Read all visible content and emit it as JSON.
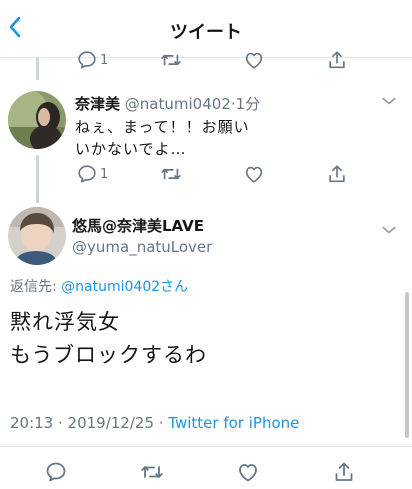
{
  "nav": {
    "title": "ツイート"
  },
  "previous_actions": {
    "reply_count": "1"
  },
  "reply_tweet": {
    "display_name": "奈津美",
    "handle": "@natumi0402",
    "separator": "·",
    "time": "1分",
    "text_line1": "ねぇ、まって！！お願い",
    "text_line2": "いかないでよ…",
    "reply_count": "1"
  },
  "main_tweet": {
    "display_name": "悠馬@奈津美LAVE",
    "handle": "@yuma_natuLover",
    "reply_prefix": "返信先: ",
    "reply_to": "@natumi0402さん",
    "text_line1": "黙れ浮気女",
    "text_line2": "もうブロックするわ",
    "timestamp": "20:13 · 2019/12/25 · ",
    "client": "Twitter for iPhone"
  },
  "colors": {
    "link": "#1b95e0",
    "secondary": "#657786",
    "divider": "#e1e8ed",
    "icon": "#657786"
  },
  "icons": [
    "back-icon",
    "reply-icon",
    "retweet-icon",
    "like-icon",
    "share-icon",
    "caret-down-icon"
  ]
}
